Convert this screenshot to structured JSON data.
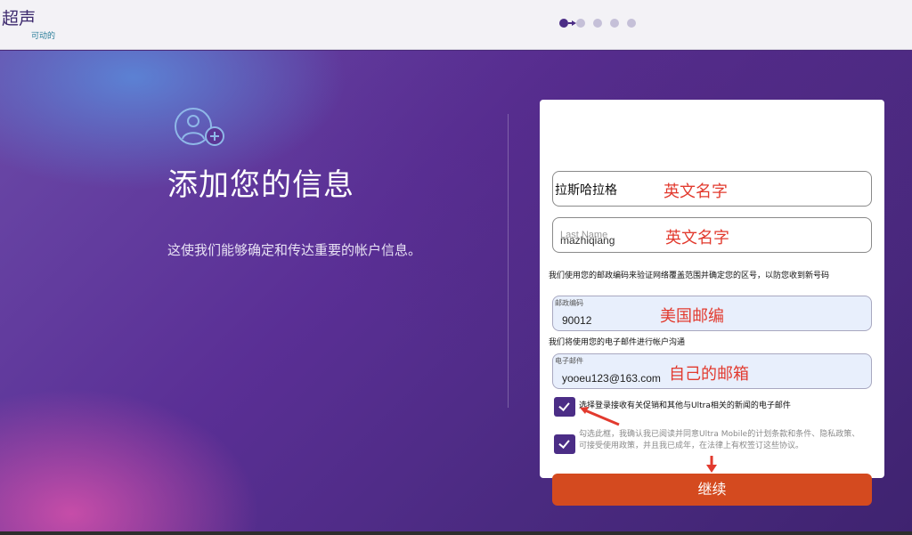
{
  "header": {
    "logo_main": "超声",
    "logo_sub": "可动的",
    "steps": {
      "total": 5,
      "current": 1
    }
  },
  "left": {
    "title": "添加您的信息",
    "description": "这使我们能够确定和传达重要的帐户信息。"
  },
  "form": {
    "first_name": {
      "value": "拉斯哈拉格",
      "annotation": "英文名字"
    },
    "last_name": {
      "placeholder": "Last Name",
      "value": "mazhiqiang",
      "annotation": "英文名字"
    },
    "zip_note": "我们使用您的邮政编码来验证网络覆盖范围并确定您的区号，以防您收到新号码",
    "zip": {
      "label": "邮政编码",
      "value": "90012",
      "annotation": "美国邮编"
    },
    "email_note": "我们将使用您的电子邮件进行帐户沟通",
    "email": {
      "label": "电子邮件",
      "value": "yooeu123@163.com",
      "annotation": "自己的邮箱"
    },
    "checkbox_promo": {
      "checked": true,
      "label": "选择登录接收有关促销和其他与Ultra相关的新闻的电子邮件"
    },
    "checkbox_terms": {
      "checked": true,
      "label_line1": "勾选此框，我确认我已阅读并同意Ultra Mobile的计划条款和条件、隐私政策、",
      "label_line2": "可接受使用政策，并且我已成年，在法律上有权签订这些协议。"
    },
    "continue_label": "继续"
  },
  "colors": {
    "accent": "#4b2d86",
    "continue": "#d44a1f",
    "annotation": "#e23a2e"
  }
}
